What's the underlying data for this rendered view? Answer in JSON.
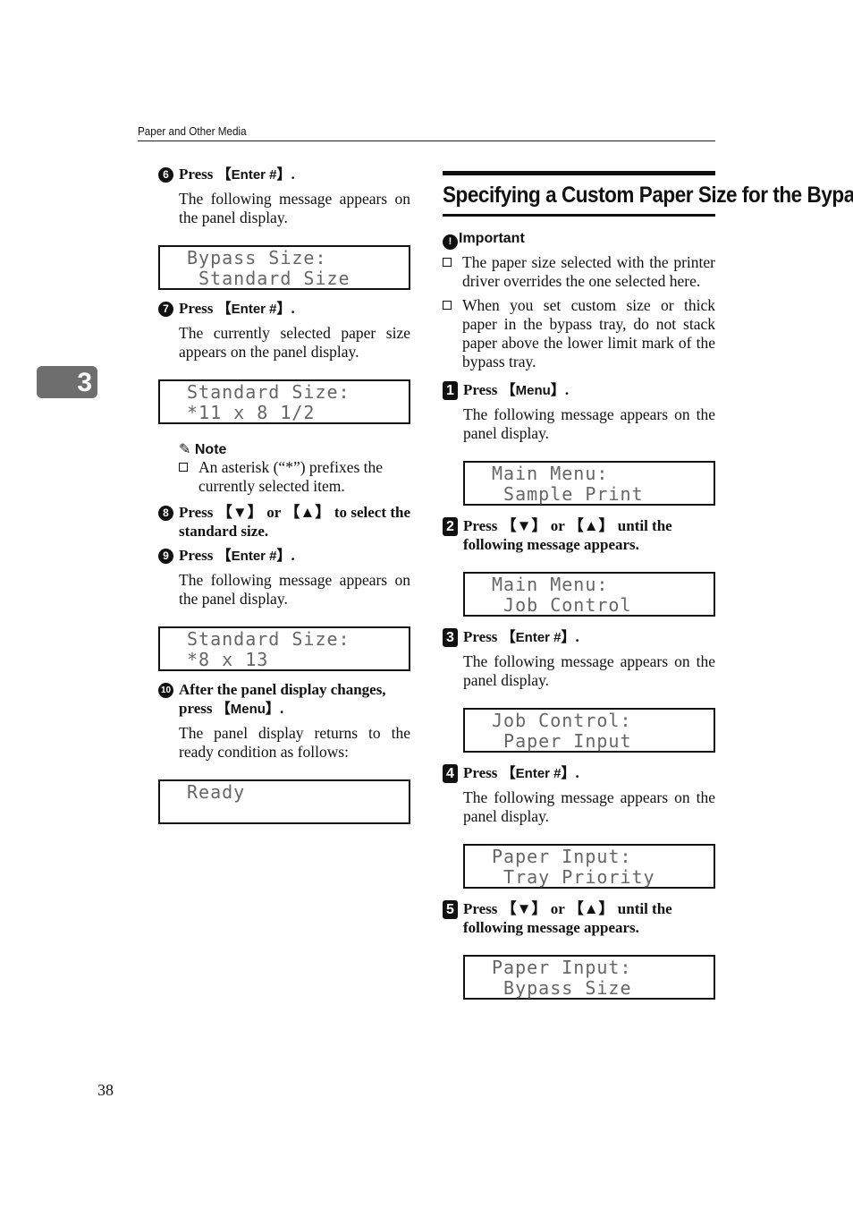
{
  "header": {
    "running_title": "Paper and Other Media"
  },
  "chapter_tab": {
    "number": "3"
  },
  "page_number": "38",
  "left_column": {
    "steps": [
      {
        "num": "6",
        "title_prefix": "Press ",
        "key": "Enter #",
        "title_suffix": ".",
        "body": "The following message appears on the panel display.",
        "panel": [
          "Bypass Size:",
          " Standard Size"
        ]
      },
      {
        "num": "7",
        "title_prefix": "Press ",
        "key": "Enter #",
        "title_suffix": ".",
        "body": "The currently selected paper size appears on the panel display.",
        "panel": [
          "Standard Size:",
          "*11 x 8 1/2"
        ]
      },
      {
        "num": "8",
        "title": "Press 【▼】 or 【▲】 to select the standard size."
      },
      {
        "num": "9",
        "title_prefix": "Press ",
        "key": "Enter #",
        "title_suffix": ".",
        "body": "The following message appears on the panel display.",
        "panel": [
          "Standard Size:",
          "*8 x 13"
        ]
      },
      {
        "num": "10",
        "title_prefix": "After the panel display changes, press ",
        "key": "Menu",
        "title_suffix": ".",
        "body": "The panel display returns to the ready condition as follows:",
        "panel": [
          "Ready",
          ""
        ]
      }
    ],
    "note": {
      "heading": "Note",
      "items": [
        "An asterisk (“*”) prefixes the currently selected item."
      ]
    }
  },
  "right_column": {
    "section_title": "Specifying a Custom Paper Size for the Bypass Tray",
    "important": {
      "heading": "Important",
      "items": [
        "The paper size selected with the printer driver overrides the one selected here.",
        "When you set custom size or thick paper in the bypass tray, do not stack paper above the lower limit mark of the bypass tray."
      ]
    },
    "steps": [
      {
        "num": "1",
        "title_prefix": "Press ",
        "key": "Menu",
        "title_suffix": ".",
        "body": "The following message appears on the panel display.",
        "panel": [
          "Main Menu:",
          " Sample Print"
        ]
      },
      {
        "num": "2",
        "title": "Press 【▼】 or 【▲】 until the following message appears.",
        "panel": [
          "Main Menu:",
          " Job Control"
        ]
      },
      {
        "num": "3",
        "title_prefix": "Press ",
        "key": "Enter #",
        "title_suffix": ".",
        "body": "The following message appears on the panel display.",
        "panel": [
          "Job Control:",
          " Paper Input"
        ]
      },
      {
        "num": "4",
        "title_prefix": "Press ",
        "key": "Enter #",
        "title_suffix": ".",
        "body": "The following message appears on the panel display.",
        "panel": [
          "Paper Input:",
          " Tray Priority"
        ]
      },
      {
        "num": "5",
        "title": "Press 【▼】 or 【▲】 until the following message appears.",
        "panel": [
          "Paper Input:",
          " Bypass Size"
        ]
      }
    ]
  },
  "icons": {
    "note": "pencil-icon",
    "important": "important-burst-icon"
  }
}
